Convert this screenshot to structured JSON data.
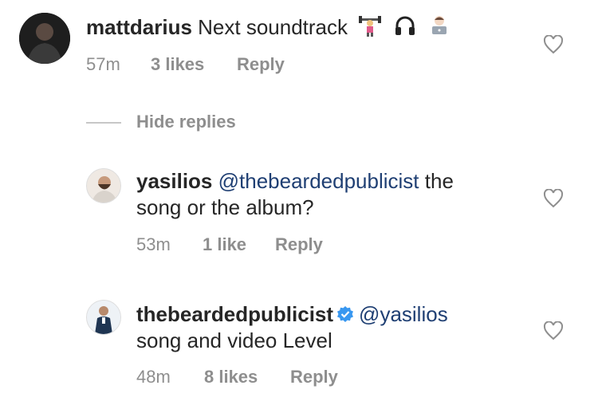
{
  "comment": {
    "username": "mattdarius",
    "text": "Next soundtrack",
    "emojis": [
      "weight-lifting-woman-emoji",
      "headphones-emoji",
      "technologist-emoji"
    ],
    "time": "57m",
    "likes": "3 likes",
    "reply": "Reply"
  },
  "replies_toggle": {
    "label": "Hide replies"
  },
  "replies": [
    {
      "username": "yasilios",
      "mention": "@thebeardedpublicist",
      "text_line1": "the",
      "text_line2": "song or the album?",
      "time": "53m",
      "likes": "1 like",
      "reply": "Reply"
    },
    {
      "username": "thebeardedpublicist",
      "verified": true,
      "mention": "@yasilios",
      "text_line2": "song and video Level",
      "time": "48m",
      "likes": "8 likes",
      "reply": "Reply"
    }
  ],
  "colors": {
    "mention": "#1f3f73",
    "meta": "#8e8e8e",
    "verified": "#3897f0"
  }
}
